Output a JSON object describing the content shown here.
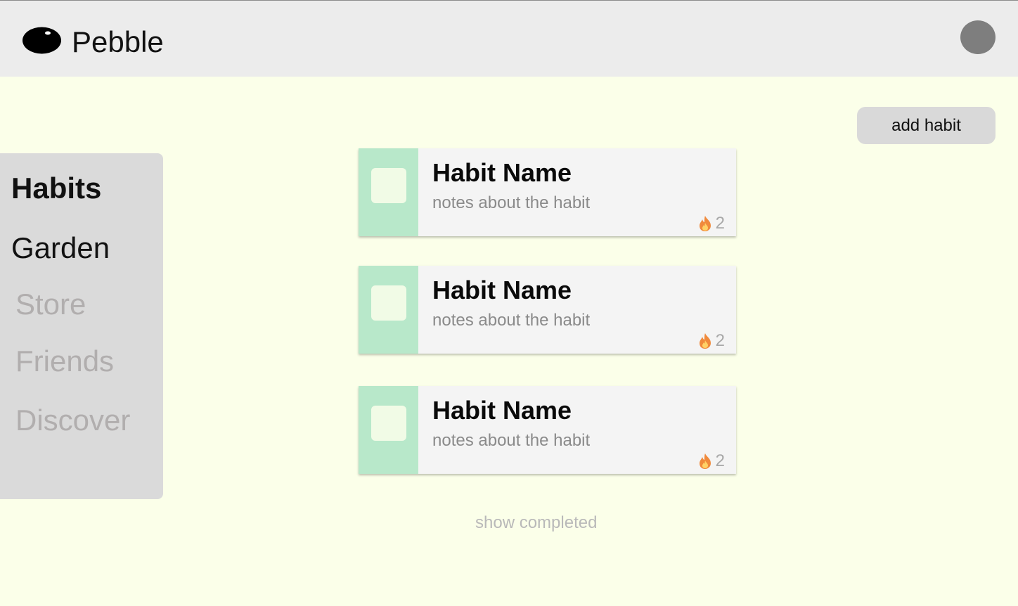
{
  "app": {
    "name": "Pebble"
  },
  "header": {
    "avatar_icon": "user-avatar-icon",
    "logo_icon": "pebble-logo-icon"
  },
  "toolbar": {
    "add_habit_label": "add habit"
  },
  "sidebar": {
    "items": [
      {
        "label": "Habits",
        "state": "active"
      },
      {
        "label": "Garden",
        "state": "normal"
      },
      {
        "label": "Store",
        "state": "disabled"
      },
      {
        "label": "Friends",
        "state": "disabled"
      },
      {
        "label": "Discover",
        "state": "disabled"
      }
    ]
  },
  "habits": [
    {
      "name": "Habit Name",
      "notes": "notes about the habit",
      "streak": "2",
      "streak_icon": "fire-icon",
      "checked": false
    },
    {
      "name": "Habit Name",
      "notes": "notes about the habit",
      "streak": "2",
      "streak_icon": "fire-icon",
      "checked": false
    },
    {
      "name": "Habit Name",
      "notes": "notes about the habit",
      "streak": "2",
      "streak_icon": "fire-icon",
      "checked": false
    }
  ],
  "footer": {
    "show_completed_label": "show completed"
  },
  "colors": {
    "page_bg": "#fbffe9",
    "header_bg": "#ececec",
    "card_accent": "#b8e8ca",
    "checkbox_bg": "#f1fbe6",
    "muted_text": "#b1aeae"
  }
}
